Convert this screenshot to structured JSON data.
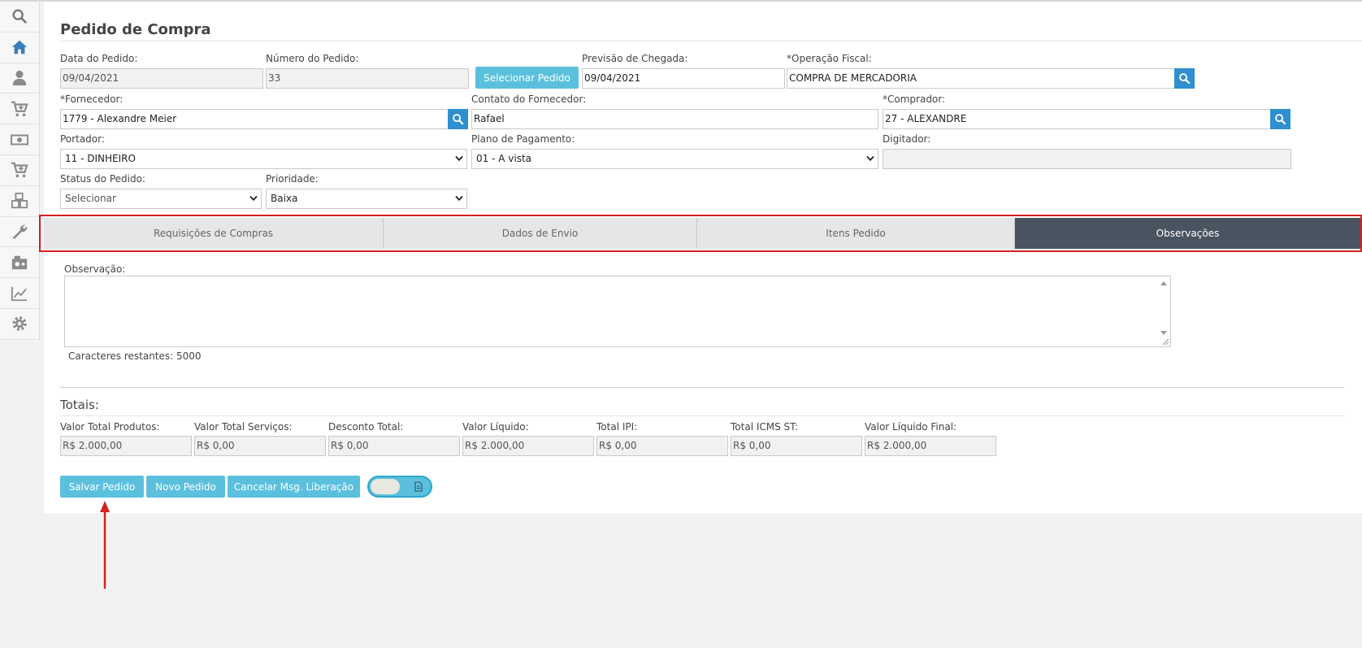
{
  "sidebar": {
    "items": [
      {
        "icon": "search-icon"
      },
      {
        "icon": "home-icon",
        "active": true
      },
      {
        "icon": "user-icon"
      },
      {
        "icon": "cart-add-icon"
      },
      {
        "icon": "money-icon"
      },
      {
        "icon": "cart-add-icon"
      },
      {
        "icon": "boxes-icon"
      },
      {
        "icon": "wrench-icon"
      },
      {
        "icon": "cash-register-icon"
      },
      {
        "icon": "chart-line-icon"
      },
      {
        "icon": "gear-icon"
      }
    ]
  },
  "page": {
    "title": "Pedido de Compra"
  },
  "form": {
    "data_pedido": {
      "label": "Data do Pedido:",
      "value": "09/04/2021"
    },
    "numero_pedido": {
      "label": "Número do Pedido:",
      "value": "33"
    },
    "selecionar_pedido": "Selecionar Pedido",
    "previsao_chegada": {
      "label": "Previsão de Chegada:",
      "value": "09/04/2021"
    },
    "operacao_fiscal": {
      "label": "*Operação Fiscal:",
      "value": "COMPRA DE MERCADORIA"
    },
    "fornecedor": {
      "label": "*Fornecedor:",
      "value": "1779 - Alexandre Meier"
    },
    "contato_fornecedor": {
      "label": "Contato do Fornecedor:",
      "value": "Rafael"
    },
    "comprador": {
      "label": "*Comprador:",
      "value": "27 - ALEXANDRE"
    },
    "portador": {
      "label": "Portador:",
      "value": "11 - DINHEIRO"
    },
    "plano_pagamento": {
      "label": "Plano de Pagamento:",
      "value": "01 - A vista"
    },
    "digitador": {
      "label": "Digitador:",
      "value": ""
    },
    "status_pedido": {
      "label": "Status do Pedido:",
      "value": "Selecionar"
    },
    "prioridade": {
      "label": "Prioridade:",
      "value": "Baixa"
    }
  },
  "tabs": [
    {
      "label": "Requisições de Compras",
      "active": false
    },
    {
      "label": "Dados de Envio",
      "active": false
    },
    {
      "label": "Itens Pedido",
      "active": false
    },
    {
      "label": "Observações",
      "active": true
    }
  ],
  "observacao": {
    "label": "Observação:",
    "value": "",
    "remaining": "Caracteres restantes: 5000"
  },
  "totais": {
    "title": "Totais:",
    "fields": [
      {
        "label": "Valor Total Produtos:",
        "value": "R$ 2.000,00"
      },
      {
        "label": "Valor Total Serviços:",
        "value": "R$ 0,00"
      },
      {
        "label": "Desconto Total:",
        "value": "R$ 0,00"
      },
      {
        "label": "Valor Líquido:",
        "value": "R$ 2.000,00"
      },
      {
        "label": "Total IPI:",
        "value": "R$ 0,00"
      },
      {
        "label": "Total ICMS ST:",
        "value": "R$ 0,00"
      },
      {
        "label": "Valor Líquido Final:",
        "value": "R$ 2.000,00"
      }
    ]
  },
  "actions": {
    "salvar": "Salvar Pedido",
    "novo": "Novo Pedido",
    "cancelar": "Cancelar Msg. Liberação"
  },
  "colors": {
    "accent": "#5bc0de",
    "search_button": "#2f8fcf",
    "active_tab": "#4a5360",
    "annotation": "#d42020"
  }
}
